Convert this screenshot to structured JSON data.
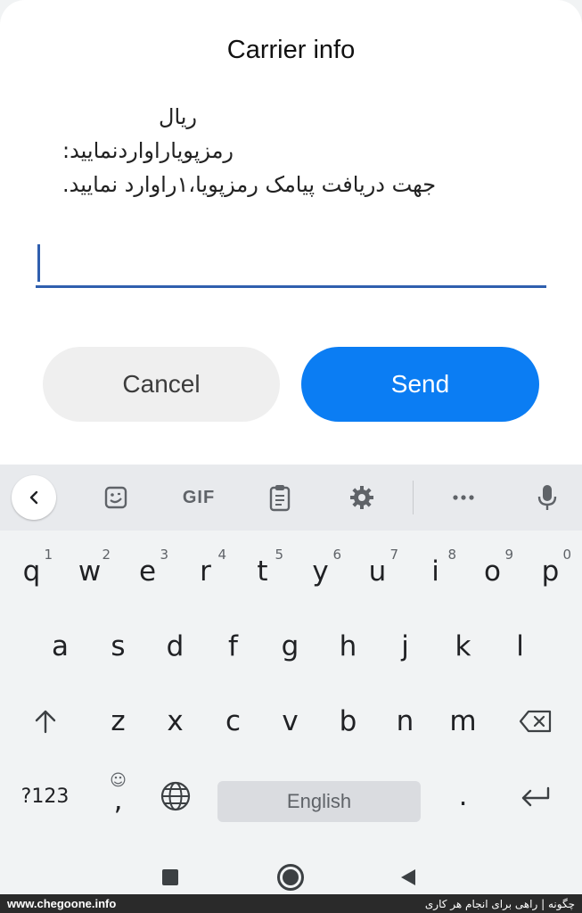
{
  "dialog": {
    "title": "Carrier info",
    "message_lines": [
      "ریال",
      "رمزپویاراواردنمایید:",
      "جهت دریافت پیامک رمزپویا،۱راوارد نمایید."
    ],
    "input_value": "",
    "cancel_label": "Cancel",
    "send_label": "Send"
  },
  "keyboard": {
    "toolbar": {
      "icons": [
        "back-chevron-icon",
        "sticker-icon",
        "gif-icon",
        "clipboard-icon",
        "settings-gear-icon",
        "more-dots-icon",
        "microphone-icon"
      ],
      "gif_label": "GIF"
    },
    "row1": [
      {
        "key": "q",
        "hint": "1"
      },
      {
        "key": "w",
        "hint": "2"
      },
      {
        "key": "e",
        "hint": "3"
      },
      {
        "key": "r",
        "hint": "4"
      },
      {
        "key": "t",
        "hint": "5"
      },
      {
        "key": "y",
        "hint": "6"
      },
      {
        "key": "u",
        "hint": "7"
      },
      {
        "key": "i",
        "hint": "8"
      },
      {
        "key": "o",
        "hint": "9"
      },
      {
        "key": "p",
        "hint": "0"
      }
    ],
    "row2": [
      "a",
      "s",
      "d",
      "f",
      "g",
      "h",
      "j",
      "k",
      "l"
    ],
    "row3": [
      "z",
      "x",
      "c",
      "v",
      "b",
      "n",
      "m"
    ],
    "symbols_label": "?123",
    "emoji_comma": ",",
    "space_label": "English",
    "period": "."
  },
  "footer": {
    "left": "www.chegoone.info",
    "right": "چگونه | راهی برای انجام هر کاری"
  },
  "colors": {
    "accent": "#0b7df3",
    "input_line": "#2f5fae",
    "keyboard_bg": "#f1f3f4"
  }
}
